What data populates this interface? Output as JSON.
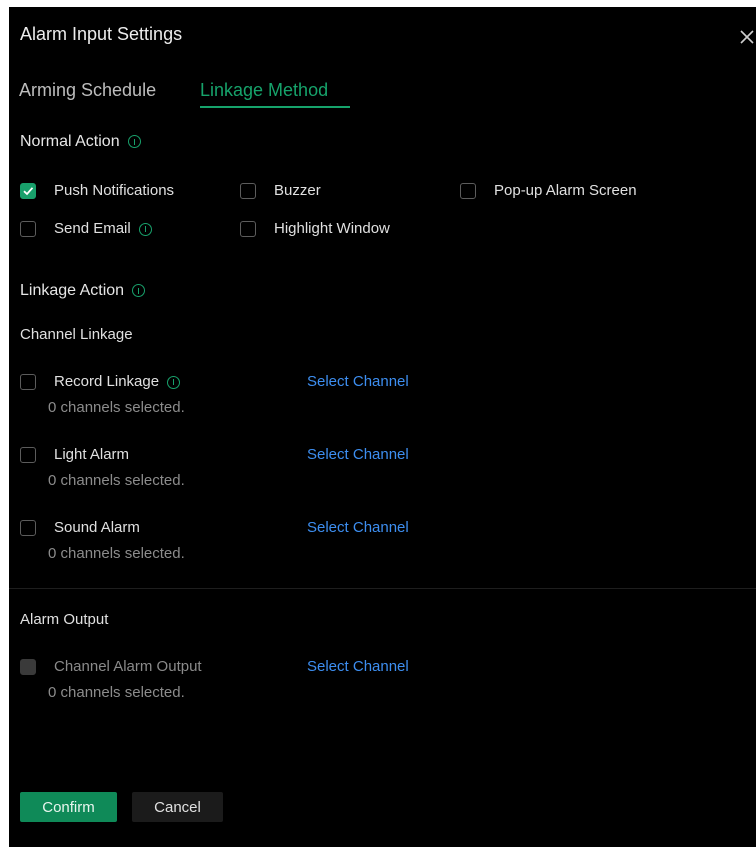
{
  "dialog": {
    "title": "Alarm Input Settings",
    "close_icon": "close-icon"
  },
  "tabs": [
    {
      "label": "Arming Schedule",
      "active": false
    },
    {
      "label": "Linkage Method",
      "active": true
    }
  ],
  "normal_action": {
    "title": "Normal Action",
    "options": [
      {
        "label": "Push Notifications",
        "checked": true
      },
      {
        "label": "Buzzer",
        "checked": false
      },
      {
        "label": "Pop-up Alarm Screen",
        "checked": false
      },
      {
        "label": "Send Email",
        "checked": false
      },
      {
        "label": "Highlight Window",
        "checked": false
      }
    ]
  },
  "linkage_action": {
    "title": "Linkage Action",
    "channel_linkage_title": "Channel Linkage",
    "items": [
      {
        "label": "Record Linkage",
        "link": "Select Channel",
        "status": "0 channels selected."
      },
      {
        "label": "Light Alarm",
        "link": "Select Channel",
        "status": "0 channels selected."
      },
      {
        "label": "Sound Alarm",
        "link": "Select Channel",
        "status": "0 channels selected."
      }
    ]
  },
  "alarm_output": {
    "title": "Alarm Output",
    "item": {
      "label": "Channel Alarm Output",
      "link": "Select Channel",
      "status": "0 channels selected."
    }
  },
  "buttons": {
    "confirm": "Confirm",
    "cancel": "Cancel"
  },
  "colors": {
    "accent": "#16a36b",
    "link": "#3d8ef0",
    "background": "#000000"
  }
}
